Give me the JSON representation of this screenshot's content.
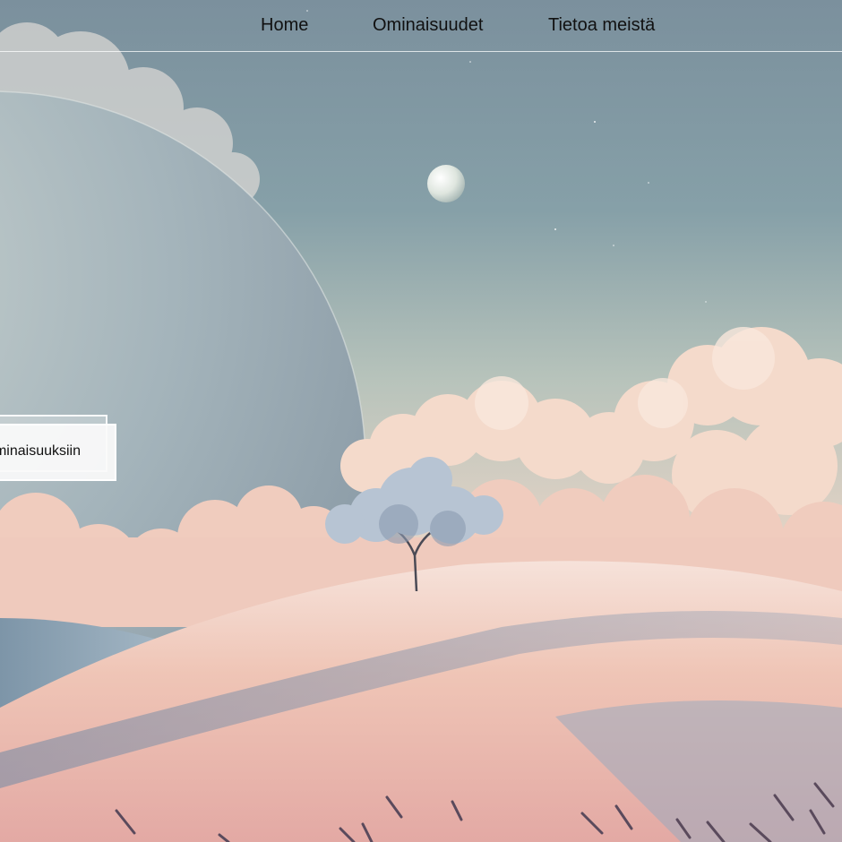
{
  "nav": {
    "home_label": "Home",
    "features_label": "Ominaisuudet",
    "about_label": "Tietoa meistä"
  },
  "cta": {
    "label": "Ominaisuuksiin"
  },
  "colors": {
    "sky_top": "#7b909d",
    "sky_bottom": "#c9cfc4",
    "planet": "#a7b6bd",
    "cloud": "#f3d6c4",
    "hill": "#efc3b3",
    "nav_text": "#111111"
  }
}
